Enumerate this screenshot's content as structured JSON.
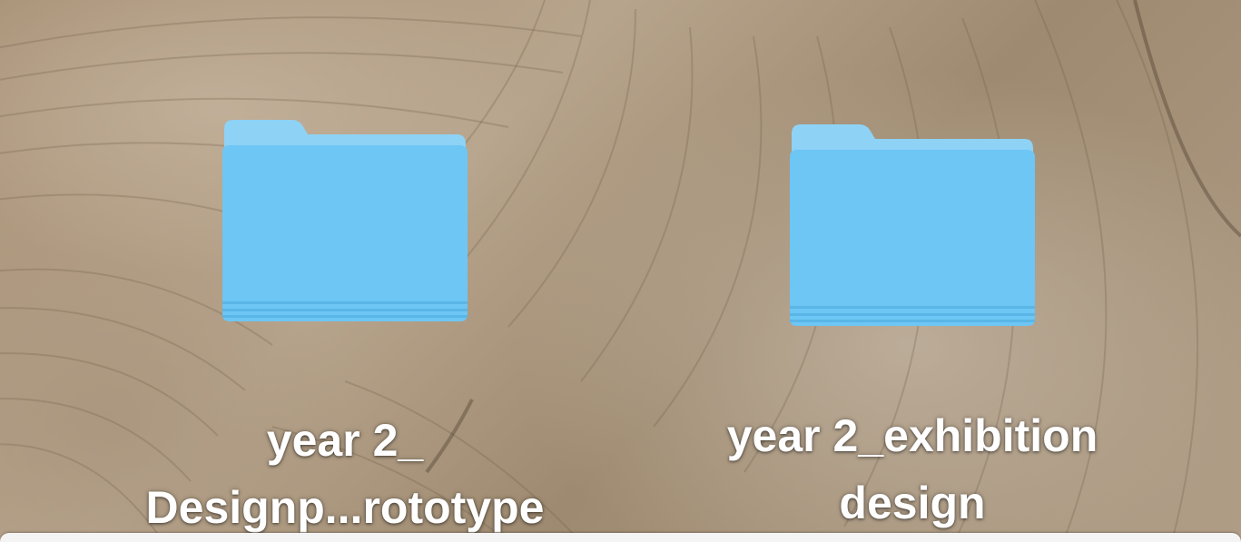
{
  "desktop": {
    "folders": [
      {
        "label_lines": [
          "year 2_",
          "Designp...rototype"
        ],
        "icon": "folder-icon"
      },
      {
        "label_lines": [
          "year 2_exhibition",
          "design"
        ],
        "icon": "folder-icon"
      }
    ]
  },
  "colors": {
    "folder_body": "#6ec6f4",
    "folder_tab": "#8ed2f6",
    "label_text": "#ffffff",
    "bottom_panel": "#f4f4f4"
  }
}
